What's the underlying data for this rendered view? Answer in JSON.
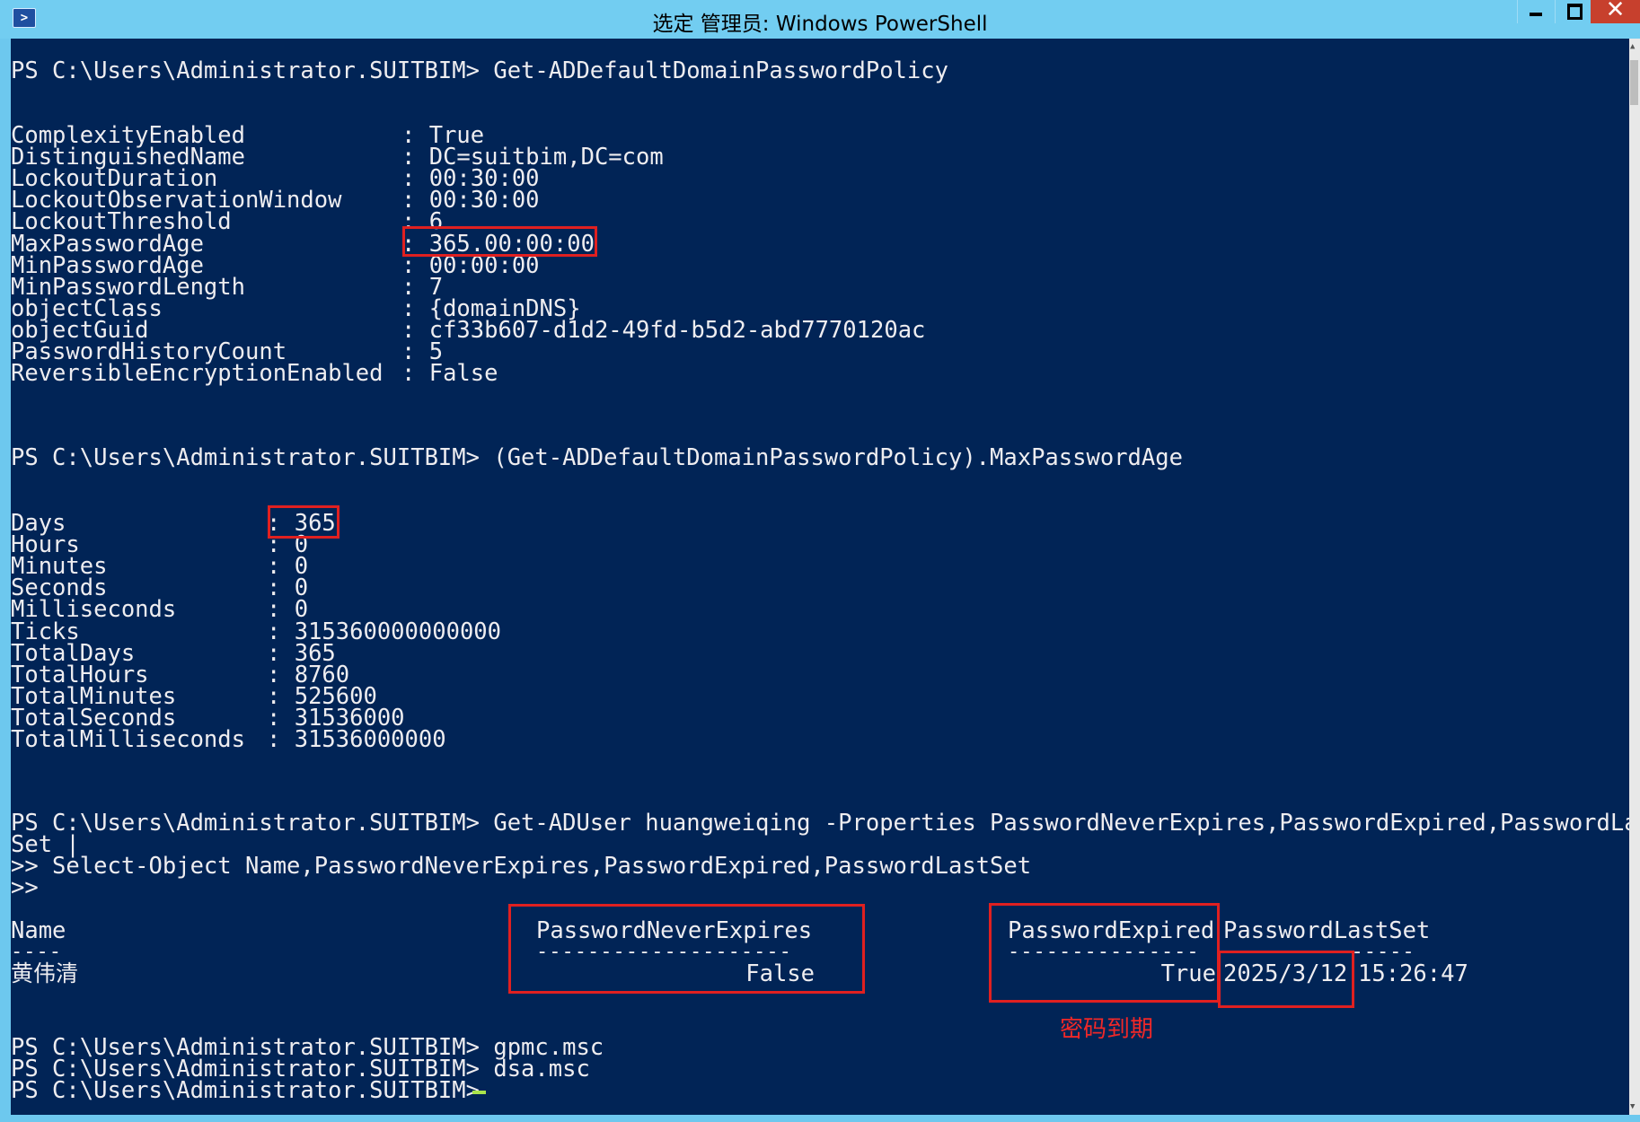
{
  "window": {
    "title": "选定 管理员: Windows PowerShell",
    "close_glyph": "✕"
  },
  "prompt": "PS C:\\Users\\Administrator.SUITBIM>",
  "commands": {
    "cmd1": "Get-ADDefaultDomainPasswordPolicy",
    "cmd2": "(Get-ADDefaultDomainPasswordPolicy).MaxPasswordAge",
    "cmd3_line1": "Get-ADUser huangweiqing -Properties PasswordNeverExpires,PasswordExpired,PasswordLast",
    "cmd3_line2": "Set |",
    "cmd3_line3": ">> Select-Object Name,PasswordNeverExpires,PasswordExpired,PasswordLastSet",
    "cmd3_line4": ">>",
    "cmd4": "gpmc.msc",
    "cmd5": "dsa.msc"
  },
  "policy": [
    {
      "key": "ComplexityEnabled",
      "value": "True"
    },
    {
      "key": "DistinguishedName",
      "value": "DC=suitbim,DC=com"
    },
    {
      "key": "LockoutDuration",
      "value": "00:30:00"
    },
    {
      "key": "LockoutObservationWindow",
      "value": "00:30:00"
    },
    {
      "key": "LockoutThreshold",
      "value": "6"
    },
    {
      "key": "MaxPasswordAge",
      "value": "365.00:00:00"
    },
    {
      "key": "MinPasswordAge",
      "value": "00:00:00"
    },
    {
      "key": "MinPasswordLength",
      "value": "7"
    },
    {
      "key": "objectClass",
      "value": "{domainDNS}"
    },
    {
      "key": "objectGuid",
      "value": "cf33b607-d1d2-49fd-b5d2-abd7770120ac"
    },
    {
      "key": "PasswordHistoryCount",
      "value": "5"
    },
    {
      "key": "ReversibleEncryptionEnabled",
      "value": "False"
    }
  ],
  "timespan": [
    {
      "key": "Days",
      "value": "365"
    },
    {
      "key": "Hours",
      "value": "0"
    },
    {
      "key": "Minutes",
      "value": "0"
    },
    {
      "key": "Seconds",
      "value": "0"
    },
    {
      "key": "Milliseconds",
      "value": "0"
    },
    {
      "key": "Ticks",
      "value": "315360000000000"
    },
    {
      "key": "TotalDays",
      "value": "365"
    },
    {
      "key": "TotalHours",
      "value": "8760"
    },
    {
      "key": "TotalMinutes",
      "value": "525600"
    },
    {
      "key": "TotalSeconds",
      "value": "31536000"
    },
    {
      "key": "TotalMilliseconds",
      "value": "31536000000"
    }
  ],
  "user_table": {
    "headers": {
      "name": "Name",
      "never_expires": "PasswordNeverExpires",
      "expired": "PasswordExpired",
      "last_set": "PasswordLastSet"
    },
    "separators": {
      "name": "----",
      "never_expires": "--------------------",
      "expired": "---------------",
      "last_set": "---------------"
    },
    "row": {
      "name": "黄伟清",
      "never_expires": "False",
      "expired": "True",
      "last_set_date": "2025/3/12",
      "last_set_time": "15:26:47"
    }
  },
  "annotation": "密码到期",
  "colors": {
    "console_background": "#012456",
    "console_text": "#eeedf0",
    "titlebar": "#72cdf1",
    "highlight": "#e02020",
    "cursor": "#a9e34b"
  }
}
